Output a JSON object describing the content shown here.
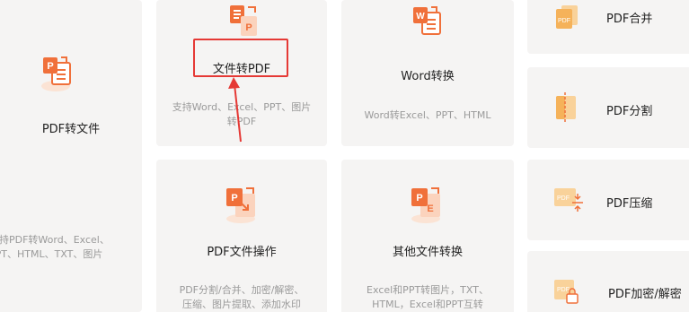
{
  "cards": {
    "pdf_to_file": {
      "title": "PDF转文件",
      "desc_line1": "支持PDF转Word、Excel、",
      "desc_line2": "PPT、HTML、TXT、图片",
      "icon": "ppt-doc-icon"
    },
    "file_to_pdf": {
      "title": "文件转PDF",
      "desc_line1": "支持Word、Excel、PPT、图片",
      "desc_line2": "转PDF",
      "icon": "doc-to-pdf-icon"
    },
    "word_convert": {
      "title": "Word转换",
      "desc": "Word转Excel、PPT、HTML",
      "icon": "word-doc-icon"
    },
    "pdf_operations": {
      "title": "PDF文件操作",
      "desc_line1": "PDF分割/合并、加密/解密、",
      "desc_line2": "压缩、图片提取、添加水印",
      "icon": "pdf-edit-icon"
    },
    "other_convert": {
      "title": "其他文件转换",
      "desc_line1": "Excel和PPT转图片，TXT、",
      "desc_line2": "HTML，Excel和PPT互转",
      "icon": "excel-doc-icon"
    }
  },
  "side": {
    "merge": {
      "label": "PDF合并",
      "icon_text": "PDF"
    },
    "split": {
      "label": "PDF分割",
      "icon_text": "PDF"
    },
    "compress": {
      "label": "PDF压缩",
      "icon_text": "PDF"
    },
    "encrypt": {
      "label": "PDF加密/解密",
      "icon_text": "PDF"
    }
  },
  "colors": {
    "accent_orange": "#f0703a",
    "highlight_red": "#e53935",
    "side_icon_orange": "#f5b25a"
  }
}
